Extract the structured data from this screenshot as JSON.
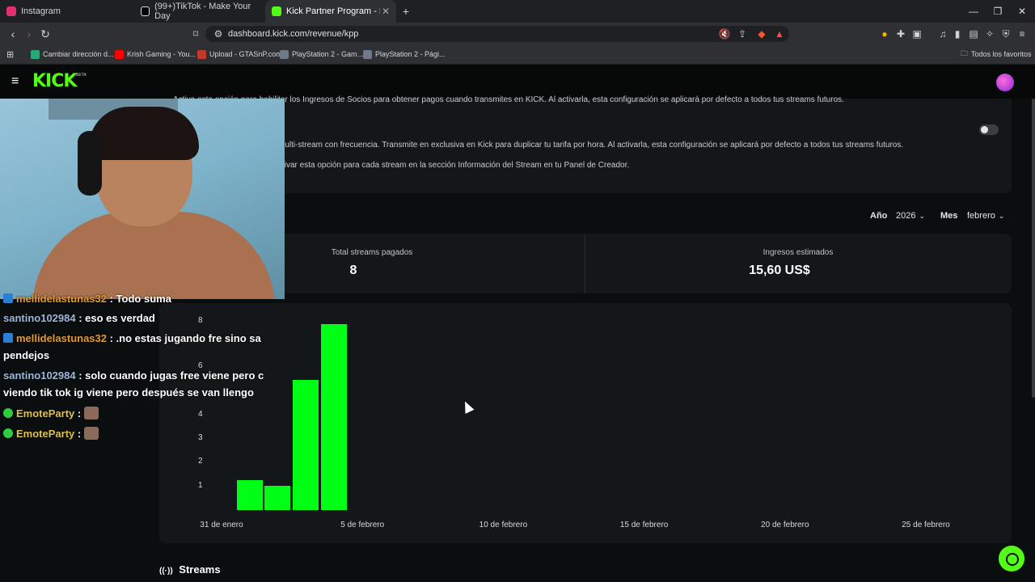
{
  "browser": {
    "tabs": [
      {
        "label": "Instagram",
        "icon": "instagram-icon",
        "color": "#e1306c"
      },
      {
        "label": "(99+)TikTok - Make Your Day",
        "icon": "tiktok-icon",
        "color": "#ffffff"
      },
      {
        "label": "Kick Partner Program - Kick Dash",
        "icon": "kick-icon",
        "color": "#53fc18"
      }
    ],
    "url": "dashboard.kick.com/revenue/kpp",
    "bookmarks": [
      {
        "label": "Cambiar dirección d...",
        "color": "#2aa876"
      },
      {
        "label": "Krish Gaming - You...",
        "color": "#ff0000"
      },
      {
        "label": "Upload - GTASnP.com",
        "color": "#c0392b"
      },
      {
        "label": "PlayStation 2 - Gam...",
        "color": "#6c7a89"
      },
      {
        "label": "PlayStation 2 - Pági...",
        "color": "#6c7a89"
      }
    ],
    "all_bookmarks": "Todos los favoritos"
  },
  "kick": {
    "logo": "KICK",
    "beta": "BETA",
    "accent": "#53fc18"
  },
  "settings": {
    "line1": "Activa esta opción para habilitar los Ingresos de Socios para obtener pagos cuando transmites en KICK. Al activarla, esta configuración se aplicará por defecto a todos tus streams futuros.",
    "line2": "multi-stream con frecuencia. Transmite en exclusiva en Kick para duplicar tu tarifa por hora. Al activarla, esta configuración se aplicará por defecto a todos tus streams futuros.",
    "line3": "ctivar esta opción para cada stream en la sección Información del Stream en tu Panel de Creador.",
    "toggle_on": false
  },
  "filters": {
    "year_label": "Año",
    "year_value": "2026",
    "month_label": "Mes",
    "month_value": "febrero"
  },
  "stats": {
    "paid_label": "Total streams pagados",
    "paid_value": "8",
    "revenue_label": "Ingresos estimados",
    "revenue_value": "15,60 US$"
  },
  "chart_data": {
    "type": "bar",
    "y_ticks": [
      "1",
      "2",
      "3",
      "4",
      "6",
      "8"
    ],
    "x_ticks": [
      "31 de enero",
      "5 de febrero",
      "10 de febrero",
      "15 de febrero",
      "20 de febrero",
      "25 de febrero"
    ],
    "values": [
      1.3,
      1.05,
      5.6,
      8
    ],
    "ylim": [
      0,
      8
    ],
    "color": "#00ff14"
  },
  "chat": [
    {
      "user": "mellidelastunas32",
      "message": " : Todo suma",
      "user_color": "#e39a2d",
      "badge": "kick-badge-icon"
    },
    {
      "user": "santino102984",
      "message": " : eso es verdad",
      "user_color": "#9db8d9",
      "badge": ""
    },
    {
      "user": "mellidelastunas32",
      "message": " : .no estas jugando fre sino sa",
      "user_color": "#e39a2d",
      "badge": "kick-badge-icon"
    },
    {
      "user": "",
      "message": "pendejos",
      "user_color": "",
      "badge": ""
    },
    {
      "user": "santino102984",
      "message": " : solo cuando jugas free viene pero c",
      "user_color": "#9db8d9",
      "badge": ""
    },
    {
      "user": "",
      "message": "viendo tik tok ig viene pero después se van llengo",
      "user_color": "",
      "badge": ""
    },
    {
      "user": "EmoteParty",
      "message": " : ",
      "user_color": "#e1c14b",
      "badge": "verified-icon"
    },
    {
      "user": "EmoteParty",
      "message": " : ",
      "user_color": "#e1c14b",
      "badge": "verified-icon"
    }
  ],
  "sections": {
    "streams": "Streams"
  }
}
